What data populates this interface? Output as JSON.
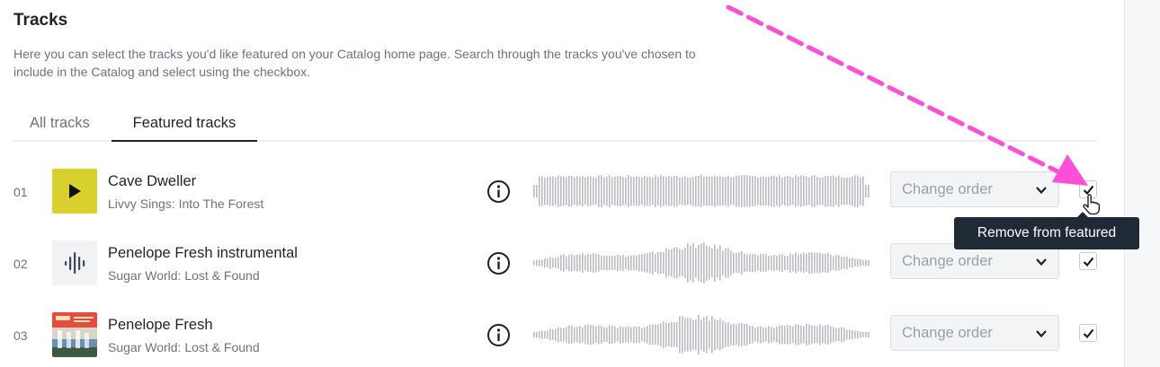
{
  "page": {
    "title": "Tracks",
    "description": "Here you can select the tracks you'd like featured on your Catalog home page. Search through the tracks you've chosen to include in the Catalog and select using the checkbox."
  },
  "tabs": [
    {
      "label": "All tracks",
      "active": false
    },
    {
      "label": "Featured tracks",
      "active": true
    }
  ],
  "tracks": [
    {
      "number": "01",
      "name": "Cave Dweller",
      "subtitle": "Livvy Sings: Into The Forest",
      "order_placeholder": "Change order",
      "featured": true,
      "artwork": "play-icon-on-yellow"
    },
    {
      "number": "02",
      "name": "Penelope Fresh instrumental",
      "subtitle": "Sugar World: Lost & Found",
      "order_placeholder": "Change order",
      "featured": true,
      "artwork": "audio-wave-icon"
    },
    {
      "number": "03",
      "name": "Penelope Fresh",
      "subtitle": "Sugar World: Lost & Found",
      "order_placeholder": "Change order",
      "featured": true,
      "artwork": "album-photo"
    }
  ],
  "tooltip": {
    "text": "Remove from featured"
  },
  "colors": {
    "annotation_arrow": "#ff4fd8",
    "tooltip_bg": "#202a36",
    "accent_art": "#d8d02d"
  }
}
